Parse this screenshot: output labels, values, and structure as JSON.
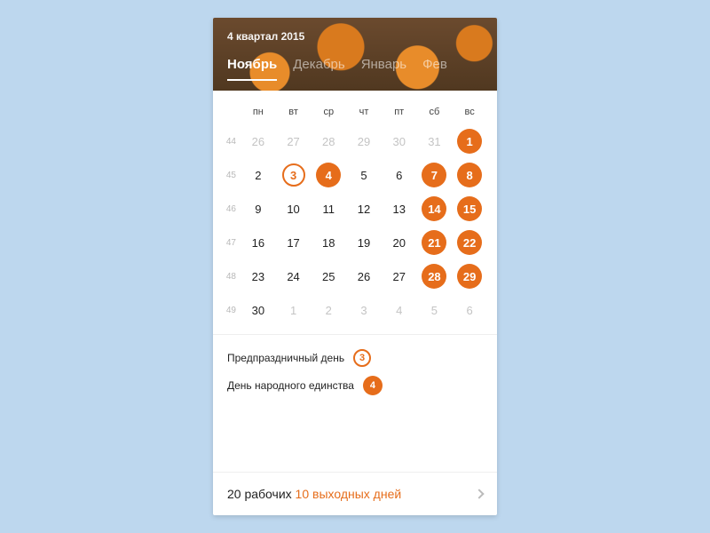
{
  "header": {
    "quarter": "4 квартал 2015",
    "tabs": [
      "Ноябрь",
      "Декабрь",
      "Январь",
      "Фев"
    ],
    "active_tab": 0
  },
  "dow": [
    "пн",
    "вт",
    "ср",
    "чт",
    "пт",
    "сб",
    "вс"
  ],
  "weeks": [
    {
      "num": 44,
      "days": [
        {
          "n": 26,
          "out": true
        },
        {
          "n": 27,
          "out": true
        },
        {
          "n": 28,
          "out": true
        },
        {
          "n": 29,
          "out": true
        },
        {
          "n": 30,
          "out": true
        },
        {
          "n": 31,
          "out": true
        },
        {
          "n": 1,
          "fill": true
        }
      ]
    },
    {
      "num": 45,
      "days": [
        {
          "n": 2
        },
        {
          "n": 3,
          "ring": true
        },
        {
          "n": 4,
          "fill": true
        },
        {
          "n": 5
        },
        {
          "n": 6
        },
        {
          "n": 7,
          "fill": true
        },
        {
          "n": 8,
          "fill": true
        }
      ]
    },
    {
      "num": 46,
      "days": [
        {
          "n": 9
        },
        {
          "n": 10
        },
        {
          "n": 11
        },
        {
          "n": 12
        },
        {
          "n": 13
        },
        {
          "n": 14,
          "fill": true
        },
        {
          "n": 15,
          "fill": true
        }
      ]
    },
    {
      "num": 47,
      "days": [
        {
          "n": 16
        },
        {
          "n": 17
        },
        {
          "n": 18
        },
        {
          "n": 19
        },
        {
          "n": 20
        },
        {
          "n": 21,
          "fill": true
        },
        {
          "n": 22,
          "fill": true
        }
      ]
    },
    {
      "num": 48,
      "days": [
        {
          "n": 23
        },
        {
          "n": 24
        },
        {
          "n": 25
        },
        {
          "n": 26
        },
        {
          "n": 27
        },
        {
          "n": 28,
          "fill": true
        },
        {
          "n": 29,
          "fill": true
        }
      ]
    },
    {
      "num": 49,
      "days": [
        {
          "n": 30
        },
        {
          "n": 1,
          "out": true
        },
        {
          "n": 2,
          "out": true
        },
        {
          "n": 3,
          "out": true
        },
        {
          "n": 4,
          "out": true
        },
        {
          "n": 5,
          "out": true
        },
        {
          "n": 6,
          "out": true
        }
      ]
    }
  ],
  "legend": [
    {
      "label": "Предпраздничный день",
      "badge": "3",
      "style": "ring"
    },
    {
      "label": "День народного единства",
      "badge": "4",
      "style": "fill"
    }
  ],
  "summary": {
    "working": "20 рабочих",
    "off": "10 выходных дней"
  },
  "colors": {
    "accent": "#e66d1b"
  }
}
